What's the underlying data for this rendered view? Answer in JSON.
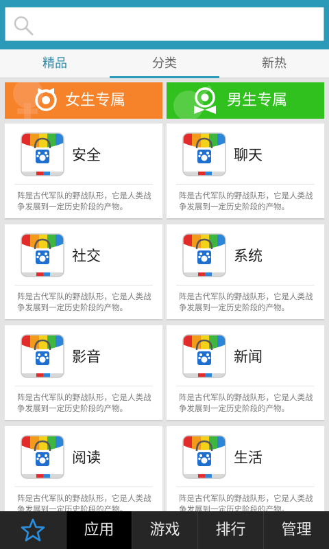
{
  "search": {
    "placeholder": "",
    "value": ""
  },
  "tabs": [
    {
      "label": "精品"
    },
    {
      "label": "分类"
    },
    {
      "label": "新热"
    }
  ],
  "banners": {
    "female": {
      "label": "女生专属",
      "color": "#f6822a"
    },
    "male": {
      "label": "男生专属",
      "color": "#30c11e"
    }
  },
  "cards": [
    {
      "title": "安全",
      "desc": "阵是古代军队的野战队形，它是人类战争发展到一定历史阶段的产物。"
    },
    {
      "title": "聊天",
      "desc": "阵是古代军队的野战队形，它是人类战争发展到一定历史阶段的产物。"
    },
    {
      "title": "社交",
      "desc": "阵是古代军队的野战队形，它是人类战争发展到一定历史阶段的产物。"
    },
    {
      "title": "系统",
      "desc": "阵是古代军队的野战队形，它是人类战争发展到一定历史阶段的产物。"
    },
    {
      "title": "影音",
      "desc": "阵是古代军队的野战队形，它是人类战争发展到一定历史阶段的产物。"
    },
    {
      "title": "新闻",
      "desc": "阵是古代军队的野战队形，它是人类战争发展到一定历史阶段的产物。"
    },
    {
      "title": "阅读",
      "desc": "阵是古代军队的野战队形，它是人类战争发展到一定历史阶段的产物。"
    },
    {
      "title": "生活",
      "desc": "阵是古代军队的野战队形，它是人类战争发展到一定历史阶段的产物。"
    }
  ],
  "bottom_nav": [
    {
      "icon": "star-icon"
    },
    {
      "label": "应用"
    },
    {
      "label": "游戏"
    },
    {
      "label": "排行"
    },
    {
      "label": "管理"
    }
  ],
  "colors": {
    "accent": "#2a9ab8",
    "nav_bg": "#262626"
  }
}
